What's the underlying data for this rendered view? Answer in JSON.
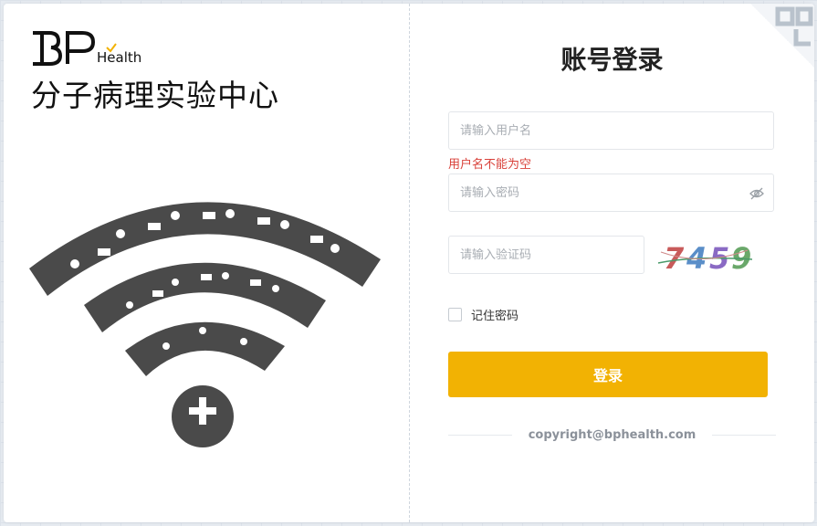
{
  "brand": {
    "logo_bp": "BP",
    "logo_health": "Health",
    "title": "分子病理实验中心"
  },
  "login": {
    "title": "账号登录",
    "username_placeholder": "请输入用户名",
    "username_error": "用户名不能为空",
    "password_placeholder": "请输入密码",
    "captcha_placeholder": "请输入验证码",
    "captcha_code": "7459",
    "remember_label": "记住密码",
    "login_button": "登录",
    "copyright": "copyright@bphealth.com"
  },
  "icons": {
    "password_toggle": "eye-off-icon",
    "illustration": "medical-wifi-illustration"
  },
  "colors": {
    "accent": "#f2b203",
    "error": "#d9413a",
    "background": "#e6ebf1"
  }
}
